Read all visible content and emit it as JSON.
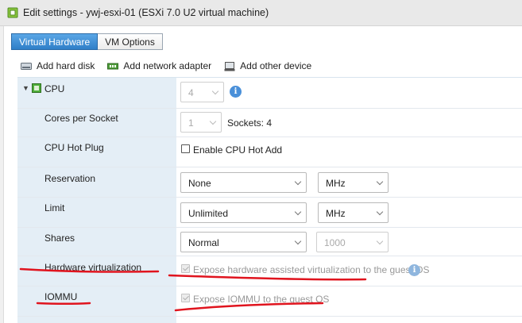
{
  "window": {
    "title": "Edit settings - ywj-esxi-01 (ESXi 7.0 U2 virtual machine)",
    "title_icon": "vm-icon"
  },
  "tabs": [
    {
      "label": "Virtual Hardware",
      "active": true
    },
    {
      "label": "VM Options",
      "active": false
    }
  ],
  "toolbar": {
    "add_hard_disk": "Add hard disk",
    "add_network_adapter": "Add network adapter",
    "add_other_device": "Add other device"
  },
  "cpu": {
    "label": "CPU",
    "count": "4",
    "cores_per_socket_label": "Cores per Socket",
    "cores_per_socket_value": "1",
    "sockets_text": "Sockets: 4",
    "hot_plug_label": "CPU Hot Plug",
    "hot_plug_option": "Enable CPU Hot Add",
    "reservation_label": "Reservation",
    "reservation_value": "None",
    "reservation_unit": "MHz",
    "limit_label": "Limit",
    "limit_value": "Unlimited",
    "limit_unit": "MHz",
    "shares_label": "Shares",
    "shares_value": "Normal",
    "shares_number": "1000",
    "hw_virt_label": "Hardware virtualization",
    "hw_virt_option": "Expose hardware assisted virtualization to the guest OS",
    "iommu_label": "IOMMU",
    "iommu_option": "Expose IOMMU to the guest OS"
  },
  "colors": {
    "accent": "#2f7fc8",
    "annotation": "#e0141e",
    "label_bg": "#e4eef6"
  }
}
